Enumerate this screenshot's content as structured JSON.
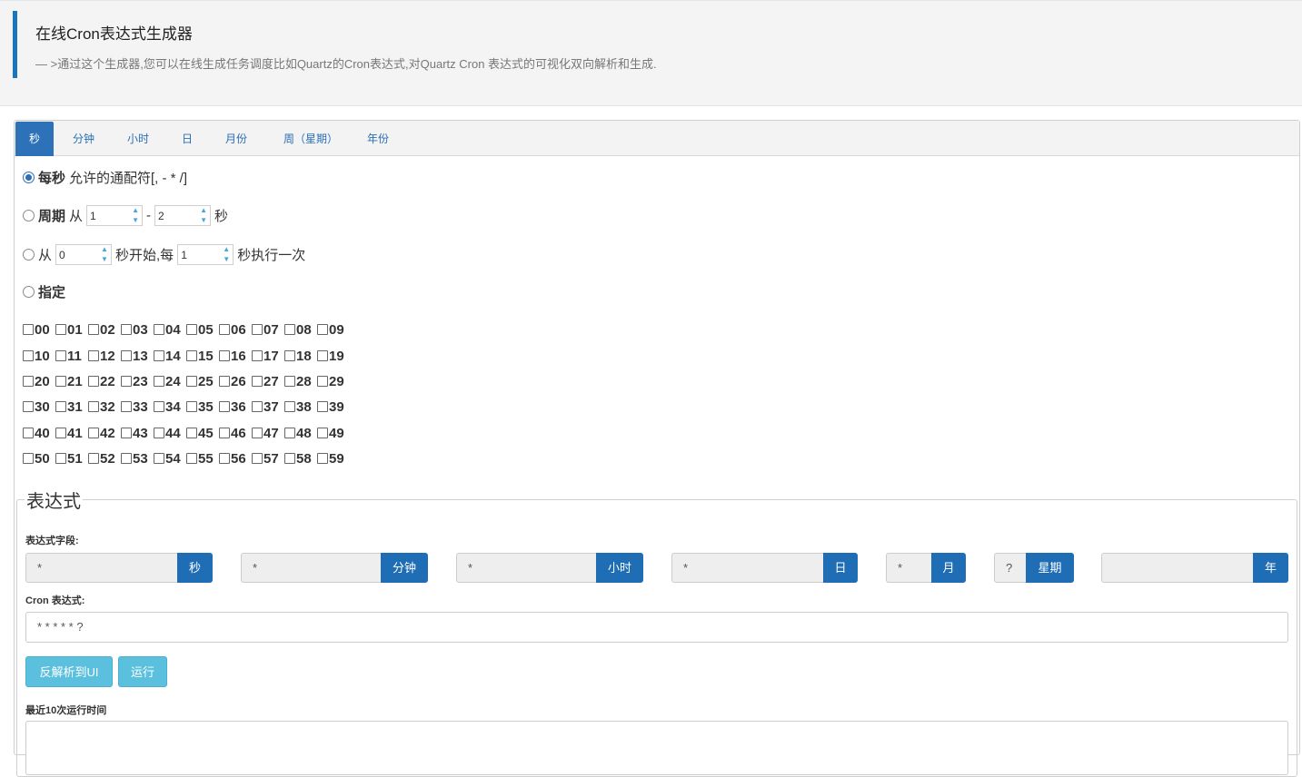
{
  "header": {
    "title": "在线Cron表达式生成器",
    "subtitle": "— >通过这个生成器,您可以在线生成任务调度比如Quartz的Cron表达式,对Quartz Cron 表达式的可视化双向解析和生成."
  },
  "tabs": [
    {
      "label": "秒",
      "active": true
    },
    {
      "label": "分钟"
    },
    {
      "label": "小时"
    },
    {
      "label": "日"
    },
    {
      "label": "月份"
    },
    {
      "label": "周（星期）"
    },
    {
      "label": "年份"
    }
  ],
  "seconds": {
    "every": {
      "bold": "每秒",
      "text": "允许的通配符[, - * /]",
      "checked": true
    },
    "cycle": {
      "bold": "周期",
      "from_label": "从",
      "from_value": "1",
      "dash": "-",
      "to_value": "2",
      "unit": "秒"
    },
    "start": {
      "from_label": "从",
      "start_value": "0",
      "mid_label": "秒开始,每",
      "every_value": "1",
      "end_label": "秒执行一次"
    },
    "specify": {
      "bold": "指定"
    },
    "values": [
      [
        "00",
        "01",
        "02",
        "03",
        "04",
        "05",
        "06",
        "07",
        "08",
        "09"
      ],
      [
        "10",
        "11",
        "12",
        "13",
        "14",
        "15",
        "16",
        "17",
        "18",
        "19"
      ],
      [
        "20",
        "21",
        "22",
        "23",
        "24",
        "25",
        "26",
        "27",
        "28",
        "29"
      ],
      [
        "30",
        "31",
        "32",
        "33",
        "34",
        "35",
        "36",
        "37",
        "38",
        "39"
      ],
      [
        "40",
        "41",
        "42",
        "43",
        "44",
        "45",
        "46",
        "47",
        "48",
        "49"
      ],
      [
        "50",
        "51",
        "52",
        "53",
        "54",
        "55",
        "56",
        "57",
        "58",
        "59"
      ]
    ]
  },
  "expression": {
    "legend": "表达式",
    "fields_label": "表达式字段:",
    "fields": [
      {
        "value": "*",
        "unit": "秒"
      },
      {
        "value": "*",
        "unit": "分钟"
      },
      {
        "value": "*",
        "unit": "小时"
      },
      {
        "value": "*",
        "unit": "日"
      },
      {
        "value": "*",
        "unit": "月"
      },
      {
        "value": "?",
        "unit": "星期"
      },
      {
        "value": "",
        "unit": "年"
      }
    ],
    "cron_label": "Cron 表达式:",
    "cron_value": "* * * * * ?",
    "reverse_button": "反解析到UI",
    "run_button": "运行",
    "recent_label": "最近10次运行时间"
  },
  "colors": {
    "accent": "#1e6db5",
    "button": "#5bc0de",
    "header_bar": "#1b75bb"
  }
}
